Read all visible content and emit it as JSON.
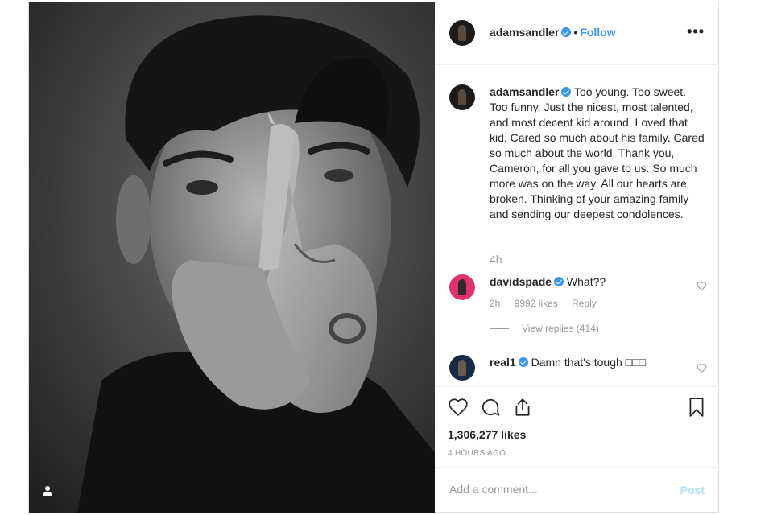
{
  "post": {
    "author": "adamsandler",
    "follow_label": "Follow",
    "dot": "•",
    "more_label": "•••",
    "caption": {
      "username": "adamsandler",
      "text": "Too young. Too sweet. Too funny. Just the nicest, most talented, and most decent kid around. Loved that kid. Cared so much about his family. Cared so much about the world. Thank you, Cameron, for all you gave to us. So much more was on the way. All our hearts are broken. Thinking of your amazing family and sending our deepest condolences.",
      "time": "4h"
    },
    "comments": [
      {
        "username": "davidspade",
        "text": "What??",
        "time": "2h",
        "likes": "9992 likes",
        "reply_label": "Reply",
        "view_replies": "View replies (414)"
      },
      {
        "username": "real1",
        "text": "Damn that's tough □□□"
      }
    ],
    "likes_count": "1,306,277 likes",
    "posted_ago": "4 HOURS AGO",
    "add_comment_placeholder": "Add a comment...",
    "post_button": "Post"
  },
  "icons": {
    "verified": "verified-badge-icon",
    "tag": "user-tag-icon",
    "like": "heart-icon",
    "comment": "comment-bubble-icon",
    "share": "share-icon",
    "save": "bookmark-icon"
  },
  "colors": {
    "accent": "#3897f0",
    "muted": "#999999",
    "border": "#efefef",
    "post_disabled": "#b2dffc"
  }
}
